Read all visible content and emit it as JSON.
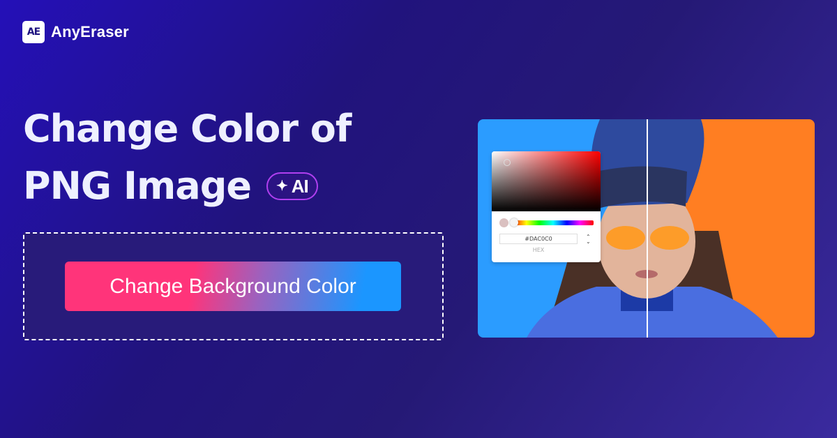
{
  "brand": {
    "logo_mark": "AE",
    "name": "AnyEraser"
  },
  "headline": {
    "line1": "Change Color of",
    "line2": "PNG Image",
    "badge_icon": "sparkle-icon",
    "badge_label": "AI"
  },
  "cta": {
    "label": "Change Background Color"
  },
  "preview": {
    "left_background": "#2B9CFF",
    "right_background": "#FF7E22",
    "color_picker": {
      "hex_value": "#DAC0C0",
      "hex_label": "HEX",
      "selected_color": "#DAC0C0",
      "stepper_up": "⌃",
      "stepper_down": "⌄"
    }
  },
  "colors": {
    "cta_start": "#FF347A",
    "cta_end": "#1B96FF",
    "badge_border": "#B03FF0"
  }
}
